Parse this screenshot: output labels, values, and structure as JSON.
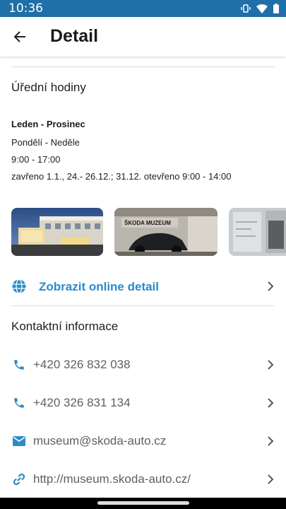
{
  "status_bar": {
    "time": "10:36",
    "icons": [
      "vibrate-icon",
      "wifi-icon",
      "battery-icon"
    ]
  },
  "app_bar": {
    "title": "Detail",
    "back_icon": "arrow-back-icon"
  },
  "opening_hours": {
    "title": "Úřední hodiny",
    "season": "Leden - Prosinec",
    "days": "Pondělí - Neděle",
    "time": "9:00 - 17:00",
    "note": "zavřeno 1.1., 24.- 26.12.; 31.12. otevřeno 9:00 - 14:00"
  },
  "gallery": {
    "photos": [
      {
        "alt": "museum-building-photo"
      },
      {
        "alt": "skoda-museum-car-photo",
        "sign_text": "ŠKODA MUZEUM"
      },
      {
        "alt": "museum-interior-photo"
      }
    ]
  },
  "online_detail": {
    "label": "Zobrazit online detail",
    "icon": "globe-icon"
  },
  "contact": {
    "title": "Kontaktní informace",
    "items": [
      {
        "type": "phone",
        "icon": "phone-icon",
        "value": "+420 326 832 038"
      },
      {
        "type": "phone",
        "icon": "phone-icon",
        "value": "+420 326 831 134"
      },
      {
        "type": "email",
        "icon": "mail-icon",
        "value": "museum@skoda-auto.cz"
      },
      {
        "type": "web",
        "icon": "link-icon",
        "value": "http://museum.skoda-auto.cz/"
      }
    ]
  },
  "colors": {
    "status_bar": "#1f6fa8",
    "accent": "#2a8bc9",
    "text": "#212121",
    "muted": "#5f5f5f"
  }
}
